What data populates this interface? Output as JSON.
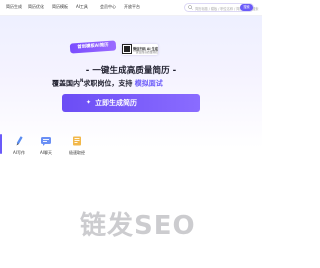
{
  "nav": {
    "items": [
      "简历生成",
      "简历优化",
      "简历模板",
      "AI工具",
      "会员中心",
      "开放平台"
    ],
    "search": {
      "placeholder": "简历标题 / 模板 / 职位名称 / 简历关键词搜索",
      "button": "搜索"
    }
  },
  "hero": {
    "badge": "首创模板AI简历",
    "qr": {
      "line1": "微信扫码 AI 生成",
      "line2": "一键生成高质量简历"
    },
    "title": "- 一键生成高质量简历 -",
    "subtitle_main": "覆盖国内",
    "subtitle_sup": "N",
    "subtitle_rest": "求职岗位，支持",
    "subtitle_highlight": "模拟面试",
    "cta_icon": "sparkle-plus-icon",
    "cta_label": "立即生成简历"
  },
  "tools": [
    {
      "label": "AI写作",
      "icon": "pen-icon"
    },
    {
      "label": "AI聊天",
      "icon": "chat-icon"
    },
    {
      "label": "极速取经",
      "icon": "book-icon"
    }
  ],
  "watermark": "链发SEO",
  "colors": {
    "accent": "#6a5af9",
    "accent_light": "#8a6cff",
    "hero_bg": "#eef0ff",
    "title": "#1f1f2e"
  }
}
